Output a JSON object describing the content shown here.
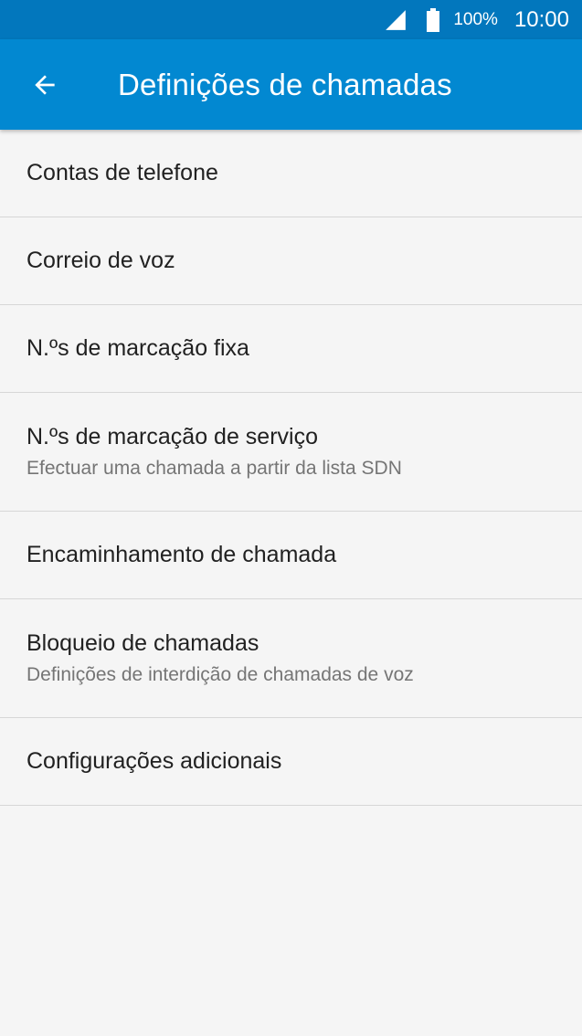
{
  "status_bar": {
    "battery_percent": "100%",
    "time": "10:00",
    "icons": [
      "cell-signal-icon",
      "battery-icon"
    ]
  },
  "app_bar": {
    "title": "Definições de chamadas",
    "back_icon": "arrow-back-icon"
  },
  "settings": {
    "items": [
      {
        "title": "Contas de telefone"
      },
      {
        "title": "Correio de voz"
      },
      {
        "title": "N.ºs de marcação fixa"
      },
      {
        "title": "N.ºs de marcação de serviço",
        "subtitle": "Efectuar uma chamada a partir da lista SDN"
      },
      {
        "title": "Encaminhamento de chamada"
      },
      {
        "title": "Bloqueio de chamadas",
        "subtitle": "Definições de interdição de chamadas de voz"
      },
      {
        "title": "Configurações adicionais"
      }
    ]
  },
  "colors": {
    "status_bar": "#0277bd",
    "app_bar": "#0288d1",
    "background": "#f5f5f5",
    "divider": "#d6d6d6",
    "primary_text": "#212121",
    "secondary_text": "#757575"
  }
}
